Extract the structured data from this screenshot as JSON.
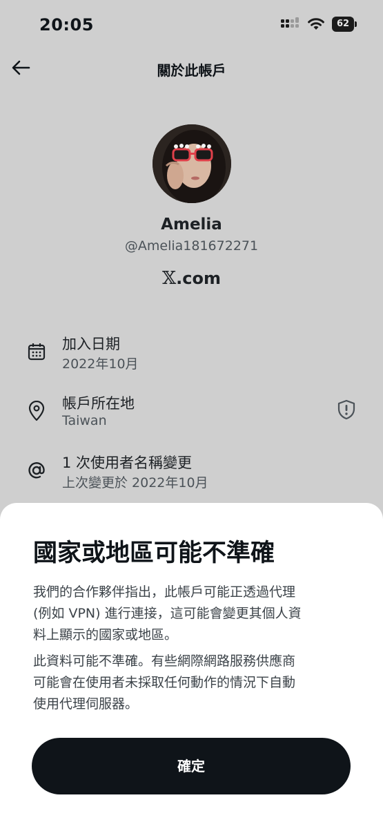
{
  "status_bar": {
    "time": "20:05",
    "battery": "62",
    "icons": [
      "signal-icon",
      "wifi-icon",
      "battery-icon"
    ]
  },
  "header": {
    "back_icon": "arrow-left-icon",
    "title": "關於此帳戶"
  },
  "profile": {
    "name": "Amelia",
    "handle": "@Amelia181672271",
    "site_letter": "𝕏",
    "site_rest": ".com"
  },
  "info": {
    "joined": {
      "icon": "calendar-icon",
      "label": "加入日期",
      "value": "2022年10月"
    },
    "location": {
      "icon": "location-pin-icon",
      "label": "帳戶所在地",
      "value": "Taiwan",
      "action_icon": "shield-alert-icon"
    },
    "username_changes": {
      "icon": "at-sign-icon",
      "label": "1 次使用者名稱變更",
      "value": "上次變更於 2022年10月"
    }
  },
  "sheet": {
    "title": "國家或地區可能不準確",
    "paragraph1": [
      "我們的合作夥伴指出，此帳戶可能正透過代理",
      "(例如 VPN) 進行連接，這可能會變更其個人資",
      "料上顯示的國家或地區。"
    ],
    "paragraph2": [
      "此資料可能不準確。有些網際網路服務供應商",
      "可能會在使用者未採取任何動作的情況下自動",
      "使用代理伺服器。"
    ],
    "confirm_label": "確定"
  },
  "colors": {
    "dimmed_background": "#cfcfcf",
    "text_primary": "#0f1419",
    "text_secondary": "#4b5258",
    "button_bg": "#0f1419",
    "sheet_bg": "#ffffff"
  }
}
